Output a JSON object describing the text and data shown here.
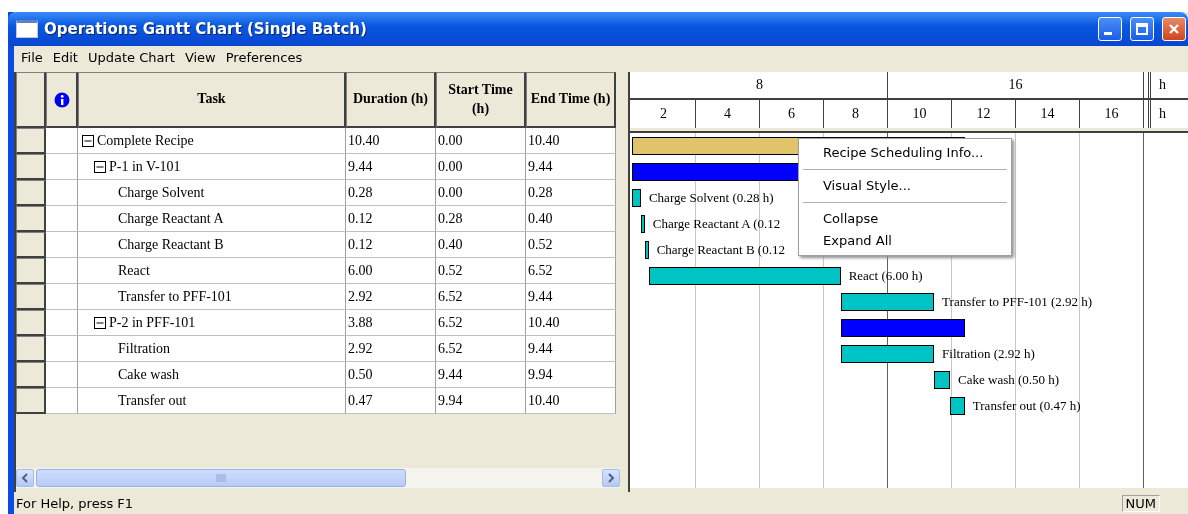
{
  "window": {
    "title": "Operations Gantt Chart (Single Batch)"
  },
  "menu": [
    "File",
    "Edit",
    "Update Chart",
    "View",
    "Preferences"
  ],
  "table": {
    "columns": [
      "Task",
      "Duration (h)",
      "Start Time (h)",
      "End Time (h)"
    ],
    "tasks": [
      {
        "task": "Complete Recipe",
        "duration": "10.40",
        "start": "0.00",
        "end": "10.40",
        "expanded": true,
        "color": "#e0c46c",
        "children": [
          {
            "task": "P-1 in V-101",
            "duration": "9.44",
            "start": "0.00",
            "end": "9.44",
            "expanded": true,
            "color": "#0000ff",
            "children": [
              {
                "task": "Charge Solvent",
                "duration": "0.28",
                "start": "0.00",
                "end": "0.28",
                "color": "#00c4c4",
                "bar_label": "Charge Solvent (0.28 h)"
              },
              {
                "task": "Charge Reactant A",
                "duration": "0.12",
                "start": "0.28",
                "end": "0.40",
                "color": "#00c4c4",
                "bar_label": "Charge Reactant A (0.12"
              },
              {
                "task": "Charge Reactant B",
                "duration": "0.12",
                "start": "0.40",
                "end": "0.52",
                "color": "#00c4c4",
                "bar_label": "Charge Reactant B (0.12"
              },
              {
                "task": "React",
                "duration": "6.00",
                "start": "0.52",
                "end": "6.52",
                "color": "#00c4c4",
                "bar_label": "React (6.00 h)"
              },
              {
                "task": "Transfer to PFF-101",
                "duration": "2.92",
                "start": "6.52",
                "end": "9.44",
                "color": "#00c4c4",
                "bar_label": "Transfer to PFF-101 (2.92 h)"
              }
            ]
          },
          {
            "task": "P-2 in PFF-101",
            "duration": "3.88",
            "start": "6.52",
            "end": "10.40",
            "expanded": true,
            "color": "#0000ff",
            "children": [
              {
                "task": "Filtration",
                "duration": "2.92",
                "start": "6.52",
                "end": "9.44",
                "color": "#00c4c4",
                "bar_label": "Filtration (2.92 h)"
              },
              {
                "task": "Cake wash",
                "duration": "0.50",
                "start": "9.44",
                "end": "9.94",
                "color": "#00c4c4",
                "bar_label": "Cake wash (0.50 h)"
              },
              {
                "task": "Transfer out",
                "duration": "0.47",
                "start": "9.94",
                "end": "10.40",
                "color": "#00c4c4",
                "bar_label": "Transfer out (0.47 h)"
              }
            ]
          }
        ]
      }
    ]
  },
  "gantt": {
    "major_ticks": [
      "8",
      "16"
    ],
    "minor_ticks": [
      "2",
      "4",
      "6",
      "8",
      "10",
      "12",
      "14",
      "16"
    ],
    "unit_labels": [
      "h",
      "h"
    ]
  },
  "context_menu": {
    "items": [
      {
        "kind": "item",
        "label": "Recipe Scheduling Info..."
      },
      {
        "kind": "separator"
      },
      {
        "kind": "item",
        "label": "Visual Style..."
      },
      {
        "kind": "separator"
      },
      {
        "kind": "item",
        "label": "Collapse"
      },
      {
        "kind": "item",
        "label": "Expand All"
      }
    ]
  },
  "status_bar": {
    "text": "For Help, press F1",
    "indicator": "NUM"
  }
}
